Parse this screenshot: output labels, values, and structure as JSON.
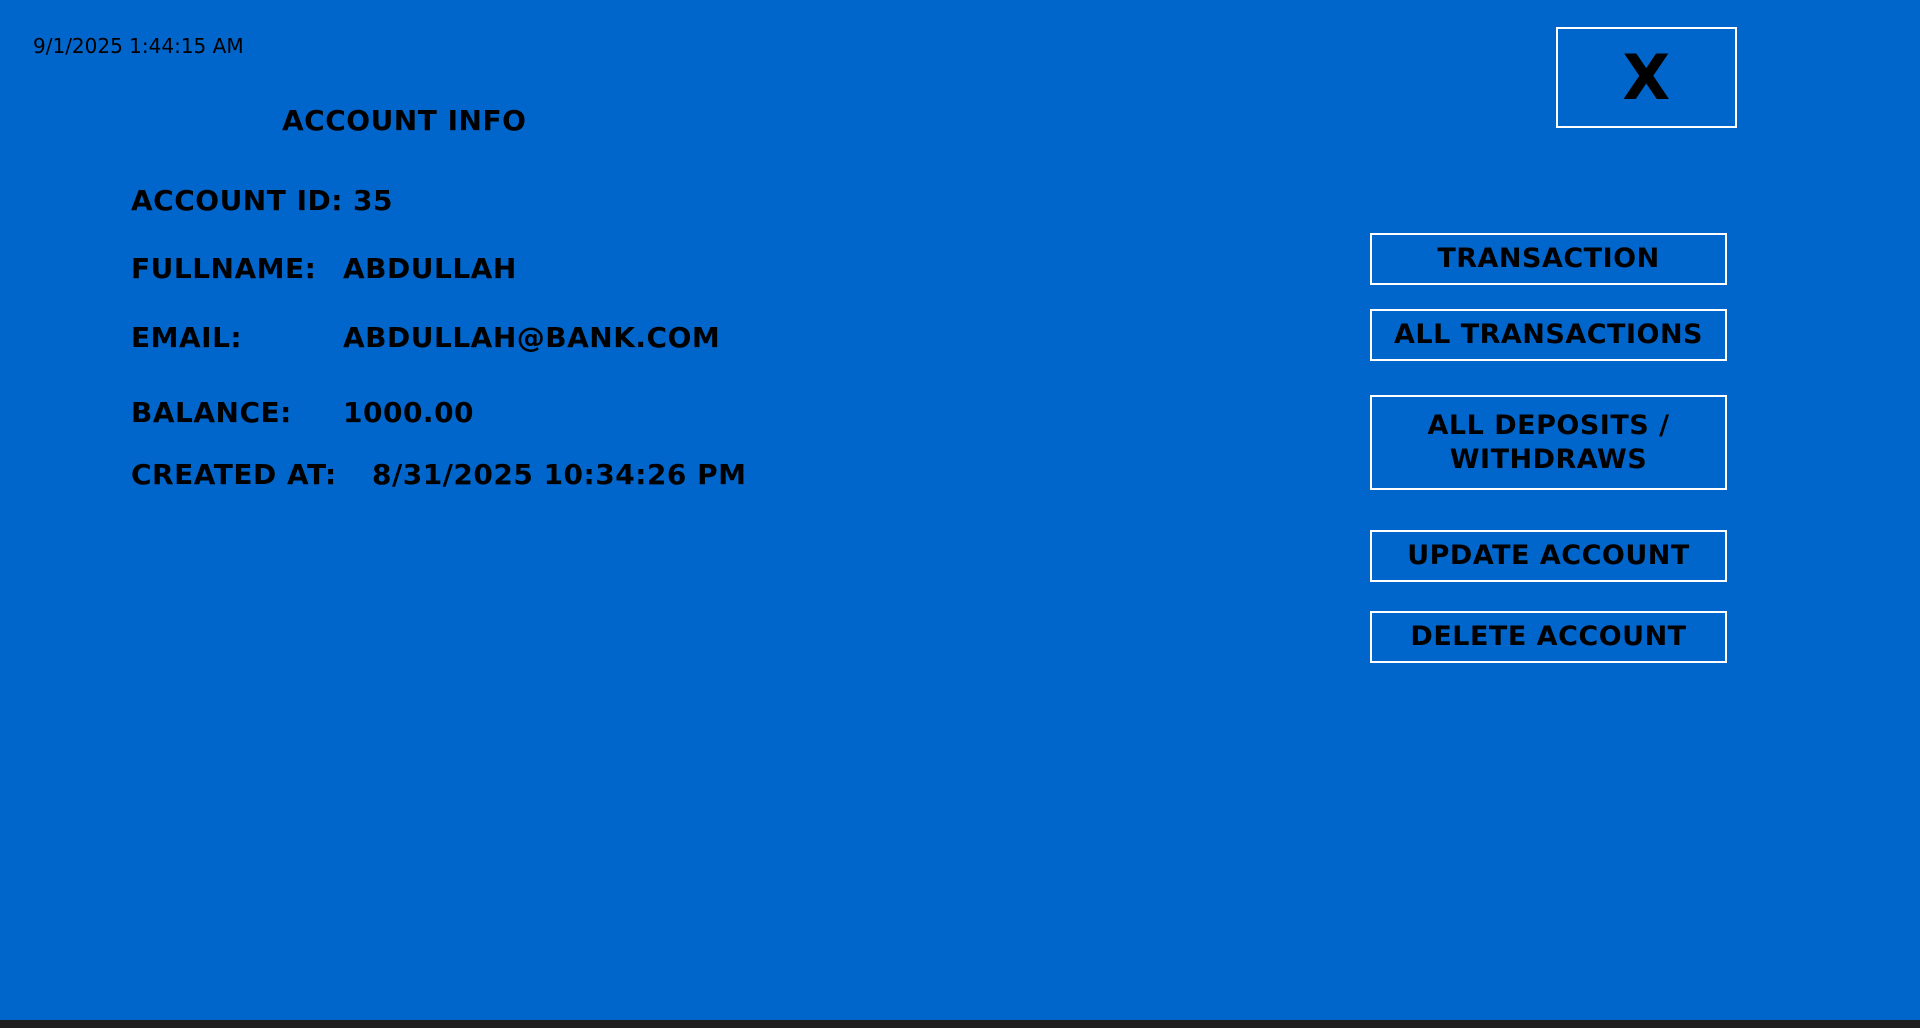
{
  "clock": "9/1/2025 1:44:15 AM",
  "title": "ACCOUNT INFO",
  "fields": {
    "account_id": {
      "label": "ACCOUNT ID:",
      "value": "35"
    },
    "fullname": {
      "label": "FULLNAME:",
      "value": "ABDULLAH"
    },
    "email": {
      "label": "EMAIL:",
      "value": "ABDULLAH@BANK.COM"
    },
    "balance": {
      "label": "BALANCE:",
      "value": "1000.00"
    },
    "created_at": {
      "label": "CREATED AT:",
      "value": "8/31/2025 10:34:26 PM"
    }
  },
  "buttons": {
    "close": "X",
    "transaction": "TRANSACTION",
    "all_transactions": "ALL TRANSACTIONS",
    "all_deposits_withdraws": "ALL DEPOSITS / WITHDRAWS",
    "update_account": "UPDATE ACCOUNT",
    "delete_account": "DELETE ACCOUNT"
  },
  "colors": {
    "background": "#0066cc",
    "button_border": "#ffffff",
    "text": "#000000"
  }
}
